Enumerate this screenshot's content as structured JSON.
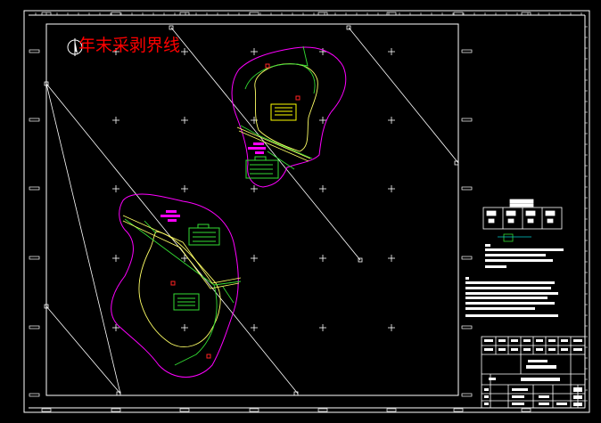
{
  "drawing": {
    "title": "年末采剥界线",
    "colors": {
      "background": "#000000",
      "frame": "#ffffff",
      "boundary": "#ff00ff",
      "contour_yellow": "#ffff66",
      "contour_green": "#33dd33",
      "label_red": "#ff2222",
      "cyan": "#00cccc"
    },
    "icons": [
      "north-arrow-icon",
      "grid-cross-icon",
      "table-block-icon"
    ]
  }
}
